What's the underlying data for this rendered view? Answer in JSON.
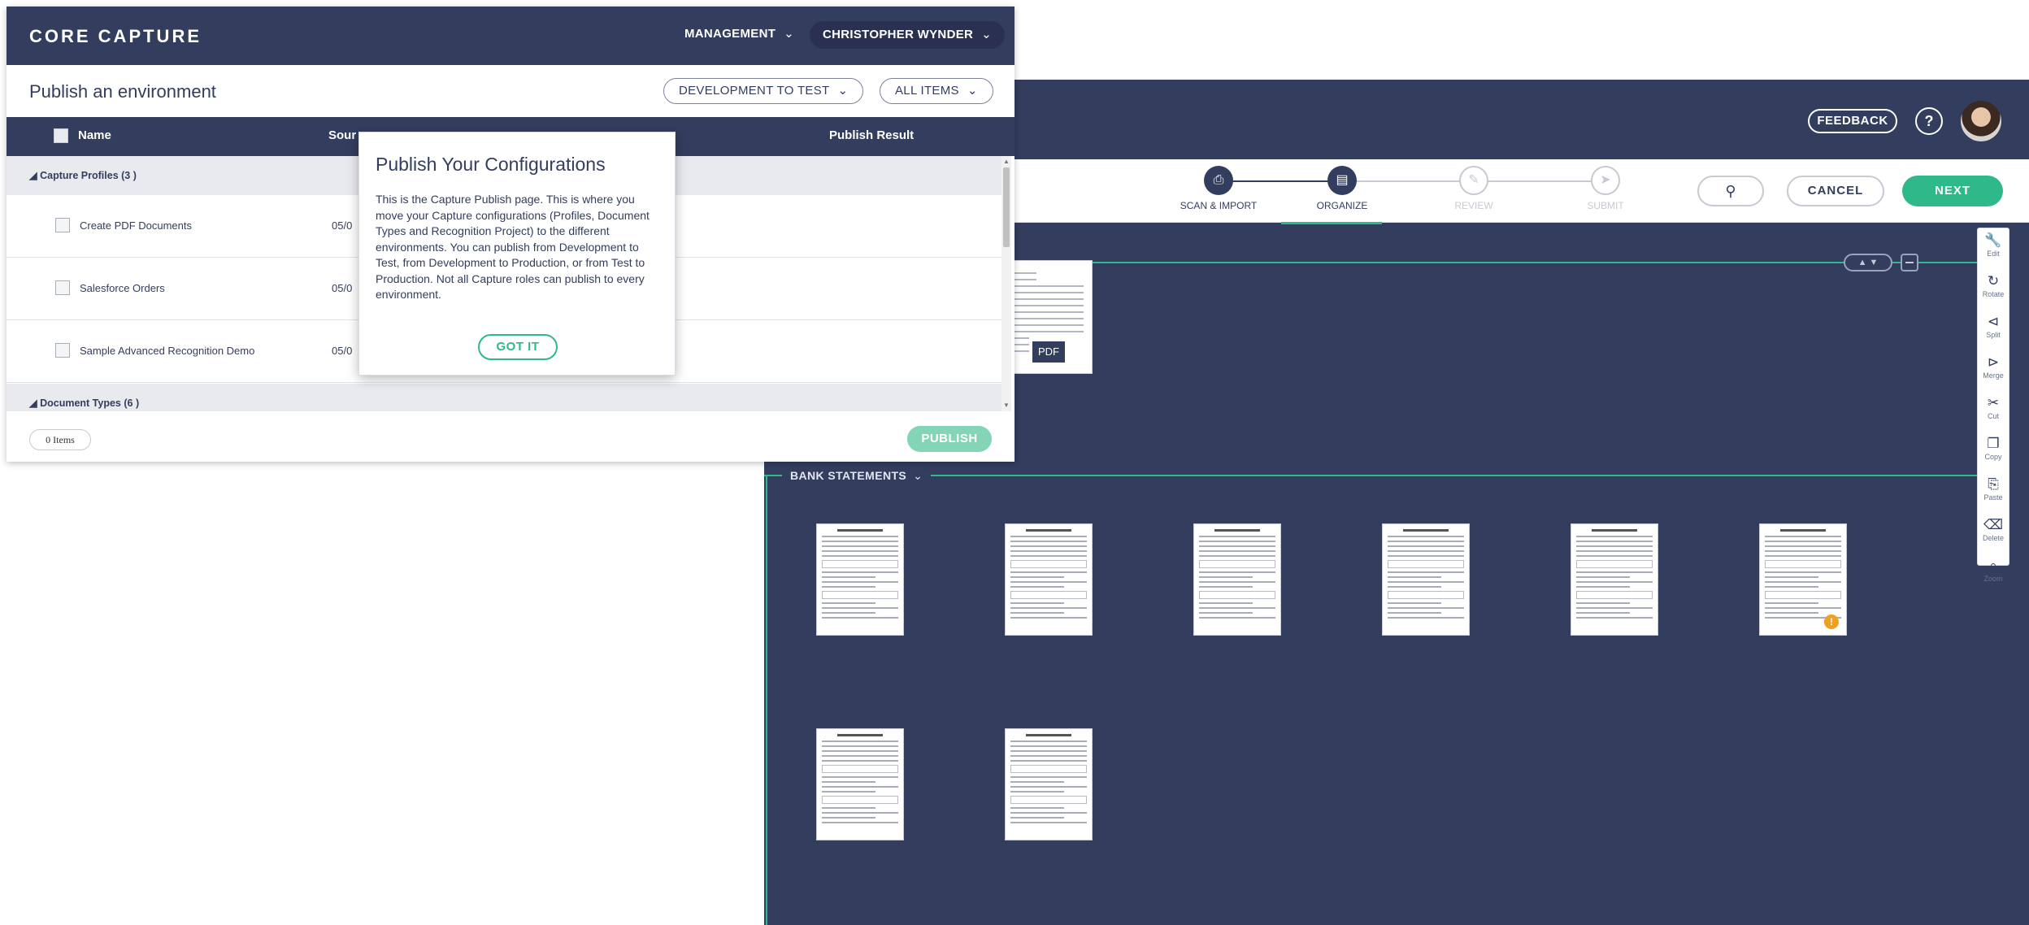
{
  "background_app": {
    "header": {
      "feedback_label": "FEEDBACK",
      "help_icon": "?"
    },
    "steps": [
      {
        "label": "SCAN & IMPORT",
        "icon": "printer-icon",
        "state": "done"
      },
      {
        "label": "ORGANIZE",
        "icon": "document-icon",
        "state": "active"
      },
      {
        "label": "REVIEW",
        "icon": "pencil-icon",
        "state": "disabled"
      },
      {
        "label": "SUBMIT",
        "icon": "send-icon",
        "state": "disabled"
      }
    ],
    "alert_icon": "!",
    "cancel_label": "CANCEL",
    "next_label": "NEXT",
    "pdf_badge": "PDF",
    "section_label": "BANK STATEMENTS",
    "tools": [
      {
        "label": "Edit",
        "icon": "wrench-icon",
        "glyph": "🔧"
      },
      {
        "label": "Rotate",
        "icon": "rotate-icon",
        "glyph": "↻"
      },
      {
        "label": "Split",
        "icon": "split-icon",
        "glyph": "⪤"
      },
      {
        "label": "Merge",
        "icon": "merge-icon",
        "glyph": "⨠"
      },
      {
        "label": "Cut",
        "icon": "scissors-icon",
        "glyph": "✂"
      },
      {
        "label": "Copy",
        "icon": "copy-icon",
        "glyph": "❐"
      },
      {
        "label": "Paste",
        "icon": "clipboard-icon",
        "glyph": "⎘"
      },
      {
        "label": "Delete",
        "icon": "trash-icon",
        "glyph": "🗑"
      },
      {
        "label": "Zoom",
        "icon": "zoom-icon",
        "glyph": "⌕"
      }
    ]
  },
  "app": {
    "title": "CORE CAPTURE",
    "management_label": "MANAGEMENT",
    "user_name": "CHRISTOPHER WYNDER"
  },
  "page": {
    "title": "Publish an environment",
    "environment_select": "DEVELOPMENT TO TEST",
    "items_filter": "ALL ITEMS"
  },
  "table": {
    "columns": {
      "name": "Name",
      "source": "Sour",
      "result": "Publish Result"
    },
    "groups": [
      {
        "label": "Capture Profiles (3 )",
        "rows": [
          {
            "name": "Create PDF Documents",
            "date": "05/0"
          },
          {
            "name": "Salesforce Orders",
            "date": "05/0"
          },
          {
            "name": "Sample Advanced Recognition Demo",
            "date": "05/0"
          }
        ]
      },
      {
        "label": "Document Types (6 )",
        "rows": []
      }
    ]
  },
  "footer": {
    "items_count": "0 Items",
    "publish_label": "PUBLISH"
  },
  "modal": {
    "title": "Publish Your Configurations",
    "body": "This is the Capture Publish page. This is where you move your Capture configurations (Profiles, Document Types and Recognition Project) to the different environments. You can publish from Development to Test, from Development to Production, or from Test to Production. Not all Capture roles can publish to every environment.",
    "button_label": "GOT IT"
  },
  "colors": {
    "navy": "#333d5e",
    "accent_green": "#2fb889",
    "publish_disabled": "#84d4b7",
    "alert_red": "#e02030",
    "warning_orange": "#f0a020"
  }
}
